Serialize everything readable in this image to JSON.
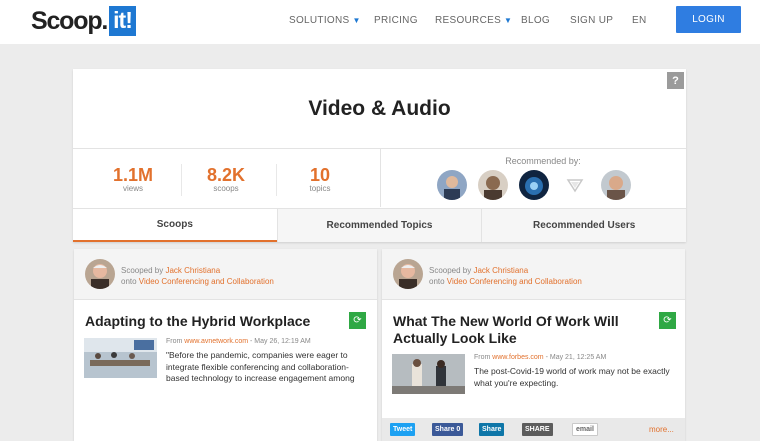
{
  "header": {
    "logo_text": "Scoop.",
    "logo_box": "it!",
    "nav": [
      {
        "label": "SOLUTIONS",
        "caret": "▼"
      },
      {
        "label": "PRICING"
      },
      {
        "label": "RESOURCES",
        "caret": "▼"
      },
      {
        "label": "BLOG"
      },
      {
        "label": "SIGN UP"
      },
      {
        "label": "EN"
      }
    ],
    "login_label": "LOGIN"
  },
  "topic": {
    "help_label": "?",
    "title": "Video & Audio",
    "stats": [
      {
        "value": "1.1M",
        "label": "views"
      },
      {
        "value": "8.2K",
        "label": "scoops"
      },
      {
        "value": "10",
        "label": "topics"
      }
    ],
    "recommended_label": "Recommended by:",
    "tabs": [
      {
        "label": "Scoops",
        "active": true
      },
      {
        "label": "Recommended Topics",
        "active": false
      },
      {
        "label": "Recommended Users",
        "active": false
      }
    ]
  },
  "posts": [
    {
      "scooped_by_prefix": "Scooped by ",
      "author": "Jack Christiana",
      "onto_prefix": "onto ",
      "topic": "Video Conferencing and Collaboration",
      "title": "Adapting to the Hybrid Workplace",
      "from_prefix": "From ",
      "source": "www.avnetwork.com",
      "date": " - May 26, 12:19 AM",
      "excerpt_short": "\"Before the pandemic, companies were eager to integrate flexible conferencing and collaboration-based technology to increase engagement among employees and conduct global meetings more effectively. Now, however, companies are looking for guidance from technology providers to help them create not only a seamless hybrid working environment, but an intuitive one, too. \""
    },
    {
      "scooped_by_prefix": "Scooped by ",
      "author": "Jack Christiana",
      "onto_prefix": "onto ",
      "topic": "Video Conferencing and Collaboration",
      "title_line1": "What The New World Of Work Will",
      "title_line2": "Actually Look Like",
      "from_prefix": "From ",
      "source": "www.forbes.com",
      "date": " - May 21, 12:25 AM",
      "excerpt_short": "The post-Covid-19 world of work may not be exactly what you're expecting.",
      "share": {
        "tweet": "Tweet",
        "share_fb": "Share 0",
        "share_in": "Share",
        "share_generic": "SHARE",
        "email": "email",
        "more": "more..."
      }
    }
  ],
  "colors": {
    "accent": "#e2712d",
    "brand_blue": "#1e78d2",
    "login_blue": "#2f7de1",
    "rescoop_green": "#2fa844"
  }
}
